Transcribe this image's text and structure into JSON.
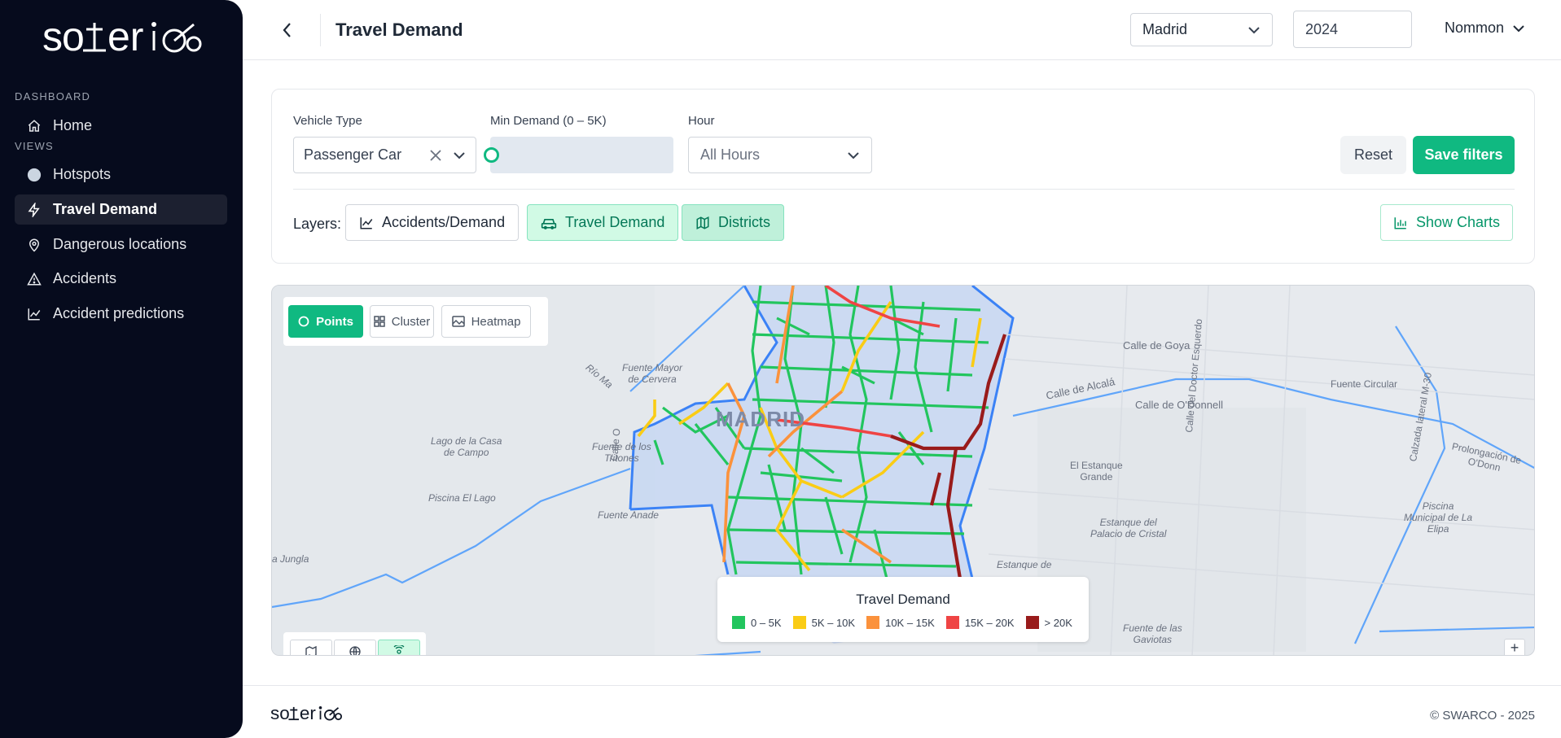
{
  "sidebar": {
    "logo_text": "soterio",
    "sections": [
      {
        "label": "DASHBOARD"
      },
      {
        "label": "VIEWS"
      }
    ],
    "items": [
      {
        "label": "Home",
        "icon": "home-icon"
      },
      {
        "label": "Hotspots",
        "icon": "circle-icon"
      },
      {
        "label": "Travel Demand",
        "icon": "bolt-icon",
        "active": true
      },
      {
        "label": "Dangerous locations",
        "icon": "map-pin-icon"
      },
      {
        "label": "Accidents",
        "icon": "warning-triangle-icon"
      },
      {
        "label": "Accident predictions",
        "icon": "trend-chart-icon"
      }
    ]
  },
  "header": {
    "title": "Travel Demand",
    "city": "Madrid",
    "year": "2024",
    "user": "Nommon"
  },
  "filters": {
    "vehicle_type_label": "Vehicle Type",
    "vehicle_type_value": "Passenger Car",
    "min_demand_label": "Min Demand (0 – 5K)",
    "min_demand_value": 0,
    "hour_label": "Hour",
    "hour_value": "All Hours",
    "reset_label": "Reset",
    "save_label": "Save filters",
    "layers_label": "Layers:",
    "layers": [
      {
        "label": "Accidents/Demand",
        "icon": "line-chart-icon",
        "active": false
      },
      {
        "label": "Travel Demand",
        "icon": "car-icon",
        "active": true
      },
      {
        "label": "Districts",
        "icon": "map-icon",
        "active": true
      }
    ],
    "show_charts_label": "Show Charts"
  },
  "map": {
    "modes": [
      {
        "label": "Points",
        "icon": "circle-outline-icon",
        "active": true
      },
      {
        "label": "Cluster",
        "icon": "grid-icon",
        "active": false
      },
      {
        "label": "Heatmap",
        "icon": "image-icon",
        "active": false
      }
    ],
    "labels": {
      "madrid": "MADRID",
      "calle_goya": "Calle de Goya",
      "calle_alcala": "Calle de Alcalá",
      "calle_odonnell": "Calle de O'Donnell",
      "fuente_circular": "Fuente Circular",
      "lago_casa": "Lago de la Casa\nde Campo",
      "piscina_lago": "Piscina El Lago",
      "jungla": "a Jungla",
      "estanque_grande": "El Estanque\nGrande",
      "estanque_palacio": "Estanque del\nPalacio de Cristal",
      "fuente_tritones": "Fuente de los\nTritones",
      "fuente_cervera": "Fuente Mayor\nde Cervera",
      "fuente_anade": "Fuente Anade",
      "fuente_gaviotas": "Fuente de las\nGaviotas",
      "piscina_elipa": "Piscina\nMunicipal de La\nElipa",
      "calle_dr_esquerdo": "Calle del Doctor Esquerdo",
      "calzada_lateral": "Calzada lateral M-30",
      "prolongacion": "Prolongación de O'Donn",
      "estanque_de": "Estanque de",
      "rio_manzanares": "Río Ma",
      "calle_o": "Calle O"
    },
    "legend": {
      "title": "Travel Demand",
      "items": [
        {
          "label": "0 – 5K",
          "color": "#22c55e"
        },
        {
          "label": "5K – 10K",
          "color": "#facc15"
        },
        {
          "label": "10K – 15K",
          "color": "#fb923c"
        },
        {
          "label": "15K – 20K",
          "color": "#ef4444"
        },
        {
          "label": "> 20K",
          "color": "#991b1b"
        }
      ]
    },
    "zoom_in_label": "+",
    "basemaps": [
      {
        "icon": "map-icon",
        "active": false
      },
      {
        "icon": "globe-icon",
        "active": false
      },
      {
        "icon": "satellite-icon",
        "active": true
      }
    ]
  },
  "footer": {
    "logo_text": "soterio",
    "copyright": "© SWARCO - 2025"
  },
  "colors": {
    "accent": "#10b981",
    "sidebar_bg": "#060b1d"
  }
}
